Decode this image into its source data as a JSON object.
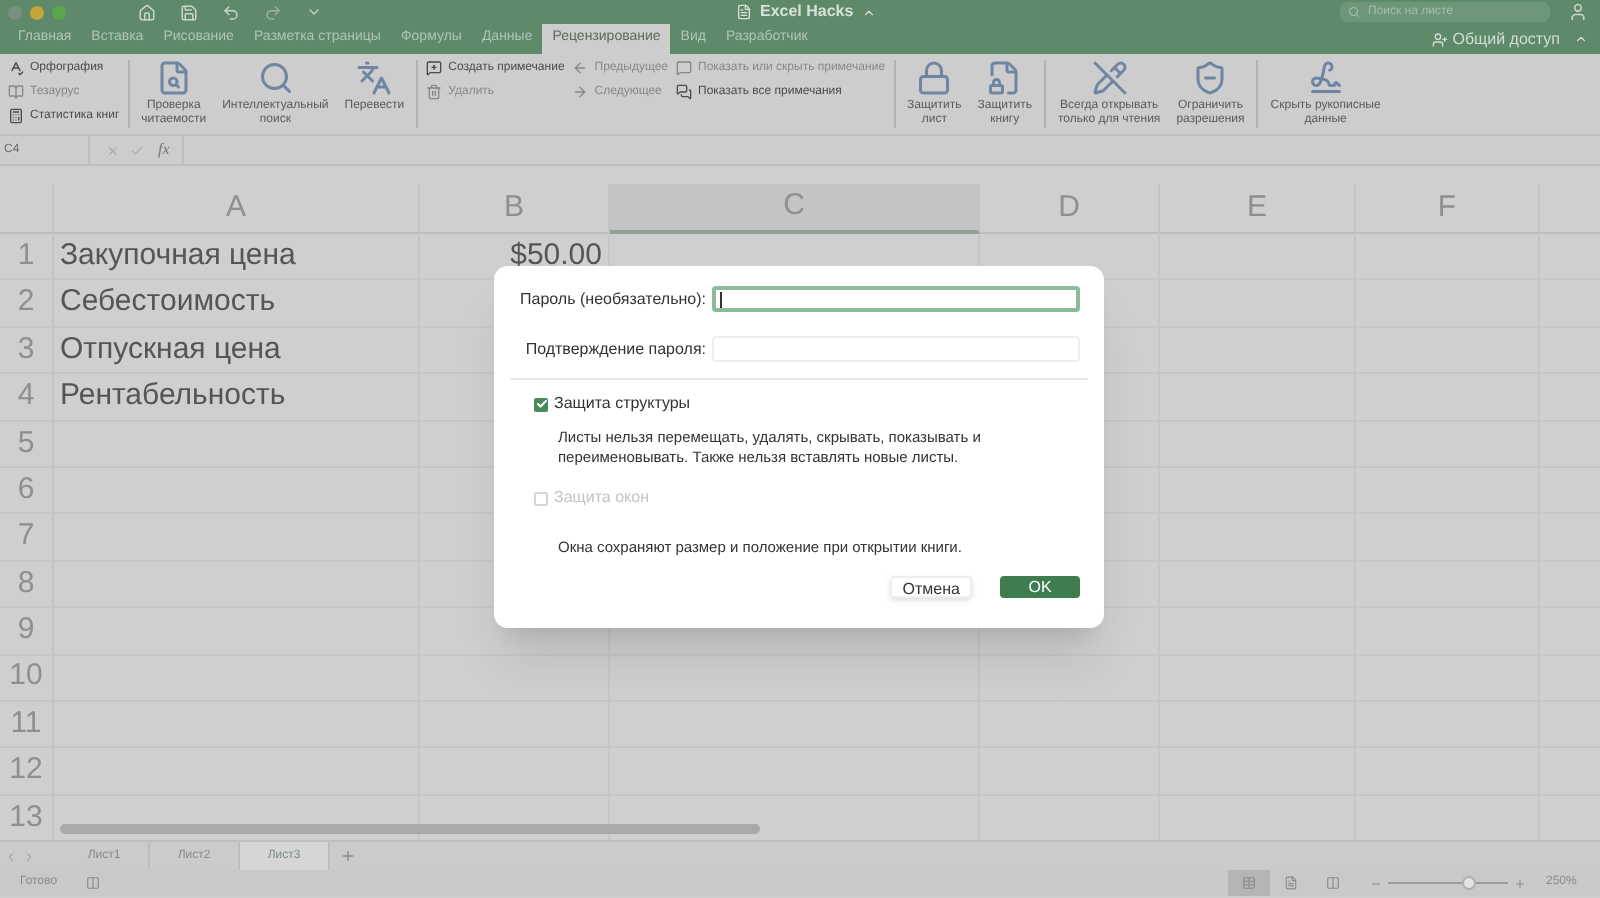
{
  "window": {
    "title": "Excel Hacks",
    "search_placeholder": "Поиск на листе"
  },
  "ribbon_tabs": [
    {
      "label": "Главная",
      "selected": false
    },
    {
      "label": "Вставка",
      "selected": false
    },
    {
      "label": "Рисование",
      "selected": false
    },
    {
      "label": "Разметка страницы",
      "selected": false
    },
    {
      "label": "Формулы",
      "selected": false
    },
    {
      "label": "Данные",
      "selected": false
    },
    {
      "label": "Рецензирование",
      "selected": true
    },
    {
      "label": "Вид",
      "selected": false
    },
    {
      "label": "Разработчик",
      "selected": false
    }
  ],
  "share": "Общий доступ",
  "ribbon_sections": [
    {
      "groups": [
        {
          "kind": "stack",
          "items": [
            {
              "label": "Орфография",
              "disabled": false
            },
            {
              "label": "Тезаурус",
              "disabled": true
            },
            {
              "label": "Статистика книг",
              "disabled": false
            }
          ]
        }
      ]
    },
    {
      "groups": [
        {
          "kind": "large",
          "items": [
            {
              "lines": [
                "Проверка",
                "читаемости"
              ],
              "disabled": false
            }
          ]
        },
        {
          "kind": "large",
          "items": [
            {
              "lines": [
                "Интеллектуальный",
                "поиск"
              ],
              "disabled": false
            }
          ]
        },
        {
          "kind": "large",
          "items": [
            {
              "lines": [
                "Перевести"
              ],
              "disabled": false
            }
          ]
        }
      ]
    },
    {
      "groups": [
        {
          "kind": "stack",
          "items": [
            {
              "label": "Создать примечание",
              "disabled": false
            },
            {
              "label": "Удалить",
              "disabled": true
            }
          ]
        },
        {
          "kind": "stack",
          "items": [
            {
              "label": "Предыдущее",
              "disabled": true
            },
            {
              "label": "Следующее",
              "disabled": true
            }
          ]
        },
        {
          "kind": "stack",
          "items": [
            {
              "label": "Показать или скрыть примечание",
              "disabled": true
            },
            {
              "label": "Показать все примечания",
              "disabled": false
            }
          ]
        }
      ]
    },
    {
      "groups": [
        {
          "kind": "large",
          "items": [
            {
              "lines": [
                "Защитить",
                "лист"
              ],
              "disabled": false
            },
            {
              "lines": [
                "Защитить",
                "книгу"
              ],
              "disabled": false
            }
          ]
        }
      ]
    },
    {
      "groups": [
        {
          "kind": "large",
          "items": [
            {
              "lines": [
                "Всегда открывать",
                "только для чтения"
              ],
              "disabled": false
            },
            {
              "lines": [
                "Ограничить",
                "разрешения"
              ],
              "disabled": false
            }
          ]
        }
      ]
    },
    {
      "groups": [
        {
          "kind": "large",
          "items": [
            {
              "lines": [
                "Скрыть рукописные",
                "данные"
              ],
              "disabled": false
            }
          ]
        }
      ]
    }
  ],
  "formula_bar": {
    "name_box": "C4",
    "fx": "fx"
  },
  "columns": [
    {
      "label": "A",
      "selected": false
    },
    {
      "label": "B",
      "selected": false
    },
    {
      "label": "C",
      "selected": true
    },
    {
      "label": "D",
      "selected": false
    },
    {
      "label": "E",
      "selected": false
    },
    {
      "label": "F",
      "selected": false
    }
  ],
  "rows": [
    {
      "number": "1",
      "cells": [
        "Закупочная цена",
        "$50.00"
      ]
    },
    {
      "number": "2",
      "cells": [
        "Себестоимость",
        ""
      ]
    },
    {
      "number": "3",
      "cells": [
        "Отпускная цена",
        ""
      ]
    },
    {
      "number": "4",
      "cells": [
        "Рентабельность",
        ""
      ]
    },
    {
      "number": "5",
      "cells": []
    },
    {
      "number": "6",
      "cells": []
    },
    {
      "number": "7",
      "cells": []
    },
    {
      "number": "8",
      "cells": []
    },
    {
      "number": "9",
      "cells": []
    },
    {
      "number": "10",
      "cells": []
    },
    {
      "number": "11",
      "cells": []
    },
    {
      "number": "12",
      "cells": []
    },
    {
      "number": "13",
      "cells": []
    }
  ],
  "sheet_tabs": [
    {
      "label": "Лист1",
      "selected": false
    },
    {
      "label": "Лист2",
      "selected": false
    },
    {
      "label": "Лист3",
      "selected": true
    }
  ],
  "status_bar": {
    "status": "Готово",
    "views": [
      {
        "kind": "normal",
        "selected": true
      },
      {
        "kind": "page",
        "selected": false
      },
      {
        "kind": "layout",
        "selected": false
      }
    ],
    "zoom_slider": {
      "level": 0.67
    },
    "zoom": "250%"
  },
  "dialog": {
    "password_label": "Пароль (необязательно):",
    "confirm_label": "Подтверждение пароля:",
    "options": [
      {
        "label": "Защита структуры",
        "checked": true,
        "disabled": false,
        "description": "Листы нельзя перемещать, удалять, скрывать, показывать и переименовывать. Также нельзя вставлять новые листы."
      },
      {
        "label": "Защита окон",
        "checked": false,
        "disabled": true,
        "description": "Окна сохраняют размер и положение при открытии книги."
      }
    ],
    "cancel": "Отмена",
    "ok": "OK"
  }
}
